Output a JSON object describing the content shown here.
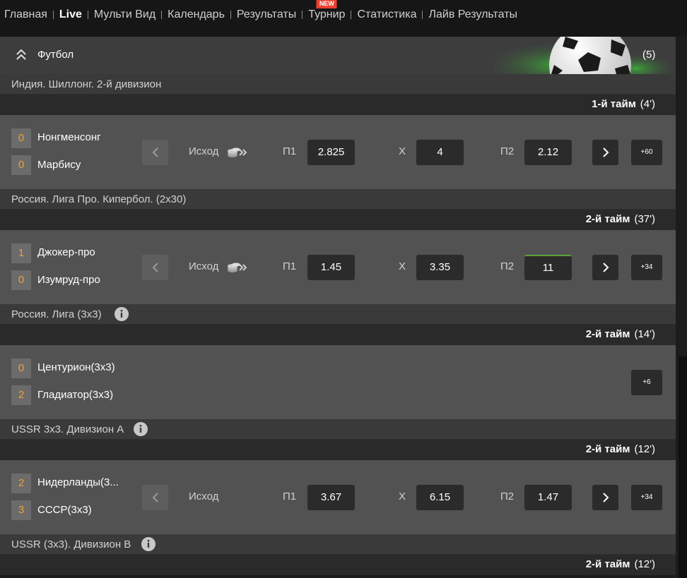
{
  "nav": {
    "items": [
      "Главная",
      "Live",
      "Мульти Вид",
      "Календарь",
      "Результаты",
      "Турнир",
      "Статистика",
      "Лайв Результаты"
    ],
    "new_badge": "NEW"
  },
  "sport": {
    "title": "Футбол",
    "count": "(5)"
  },
  "labels": {
    "market": "Исход",
    "p1": "П1",
    "x": "Х",
    "p2": "П2"
  },
  "leagues": [
    {
      "name": "Индия. Шиллонг. 2-й дивизион",
      "period": "1-й тайм",
      "clock": "(4')",
      "team1": "Нонгменсонг",
      "score1": "0",
      "team2": "Марбису",
      "score2": "0",
      "odds": {
        "p1": "2.825",
        "x": "4",
        "p2": "2.12"
      },
      "more": "+60"
    },
    {
      "name": "Россия. Лига Про. Кипербол. (2x30)",
      "period": "2-й тайм",
      "clock": "(37')",
      "team1": "Джокер-про",
      "score1": "1",
      "team2": "Изумруд-про",
      "score2": "0",
      "odds": {
        "p1": "1.45",
        "x": "3.35",
        "p2": "11"
      },
      "more": "+34"
    },
    {
      "name": "Россия. Лига (3x3)",
      "period": "2-й тайм",
      "clock": "(14')",
      "team1": "Центурион(3x3)",
      "score1": "0",
      "team2": "Гладиатор(3x3)",
      "score2": "2",
      "more": "+6"
    },
    {
      "name": "USSR 3x3. Дивизион А",
      "period": "2-й тайм",
      "clock": "(12')",
      "team1": "Нидерланды(3...",
      "score1": "2",
      "team2": "СССР(3x3)",
      "score2": "3",
      "odds": {
        "p1": "3.67",
        "x": "6.15",
        "p2": "1.47"
      },
      "more": "+34"
    },
    {
      "name": "USSR (3x3). Дивизион B",
      "period": "2-й тайм",
      "clock": "(12')"
    }
  ]
}
